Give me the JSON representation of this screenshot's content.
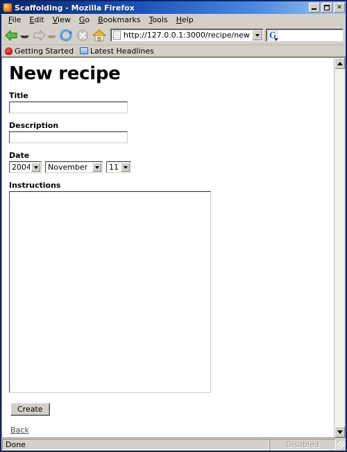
{
  "window": {
    "title": "Scaffolding - Mozilla Firefox",
    "app_icon": "firefox-icon",
    "minimize_label": "_",
    "maximize_label": "",
    "close_label": "✕"
  },
  "menubar": {
    "items": [
      {
        "label": "File",
        "accesskey": "F"
      },
      {
        "label": "Edit",
        "accesskey": "E"
      },
      {
        "label": "View",
        "accesskey": "V"
      },
      {
        "label": "Go",
        "accesskey": "G"
      },
      {
        "label": "Bookmarks",
        "accesskey": "B"
      },
      {
        "label": "Tools",
        "accesskey": "T"
      },
      {
        "label": "Help",
        "accesskey": "H"
      }
    ]
  },
  "toolbar": {
    "back_icon": "back-arrow-icon",
    "forward_icon": "forward-arrow-icon",
    "reload_icon": "reload-icon",
    "stop_icon": "stop-icon",
    "home_icon": "home-icon",
    "url_value": "http://127.0.0.1:3000/recipe/new",
    "url_icon": "page-document-icon",
    "url_dropdown_icon": "chevron-down-icon",
    "search_value": "",
    "search_engine_icon": "google-g-icon"
  },
  "bookmarks": {
    "items": [
      {
        "label": "Getting Started",
        "icon": "firefox-bookmark-icon"
      },
      {
        "label": "Latest Headlines",
        "icon": "folder-icon"
      }
    ]
  },
  "page": {
    "heading": "New recipe",
    "fields": {
      "title": {
        "label": "Title",
        "value": "",
        "placeholder": ""
      },
      "description": {
        "label": "Description",
        "value": "",
        "placeholder": ""
      },
      "date": {
        "label": "Date",
        "year": "2004",
        "month": "November",
        "day": "11"
      },
      "instructions": {
        "label": "Instructions",
        "value": "",
        "placeholder": ""
      }
    },
    "submit_label": "Create",
    "back_link_label": "Back"
  },
  "scrollbar": {
    "up_icon": "scroll-up-arrow-icon",
    "down_icon": "scroll-down-arrow-icon"
  },
  "statusbar": {
    "status_text": "Done",
    "security_text": "Disabled",
    "resize_grip_icon": "resize-grip-icon"
  },
  "colors": {
    "titlebar_start": "#0a246a",
    "titlebar_end": "#a8c6ef",
    "chrome": "#d4d0c8",
    "page_bg": "#ffffff",
    "text": "#000000",
    "disabled_text": "#9d9a92"
  }
}
